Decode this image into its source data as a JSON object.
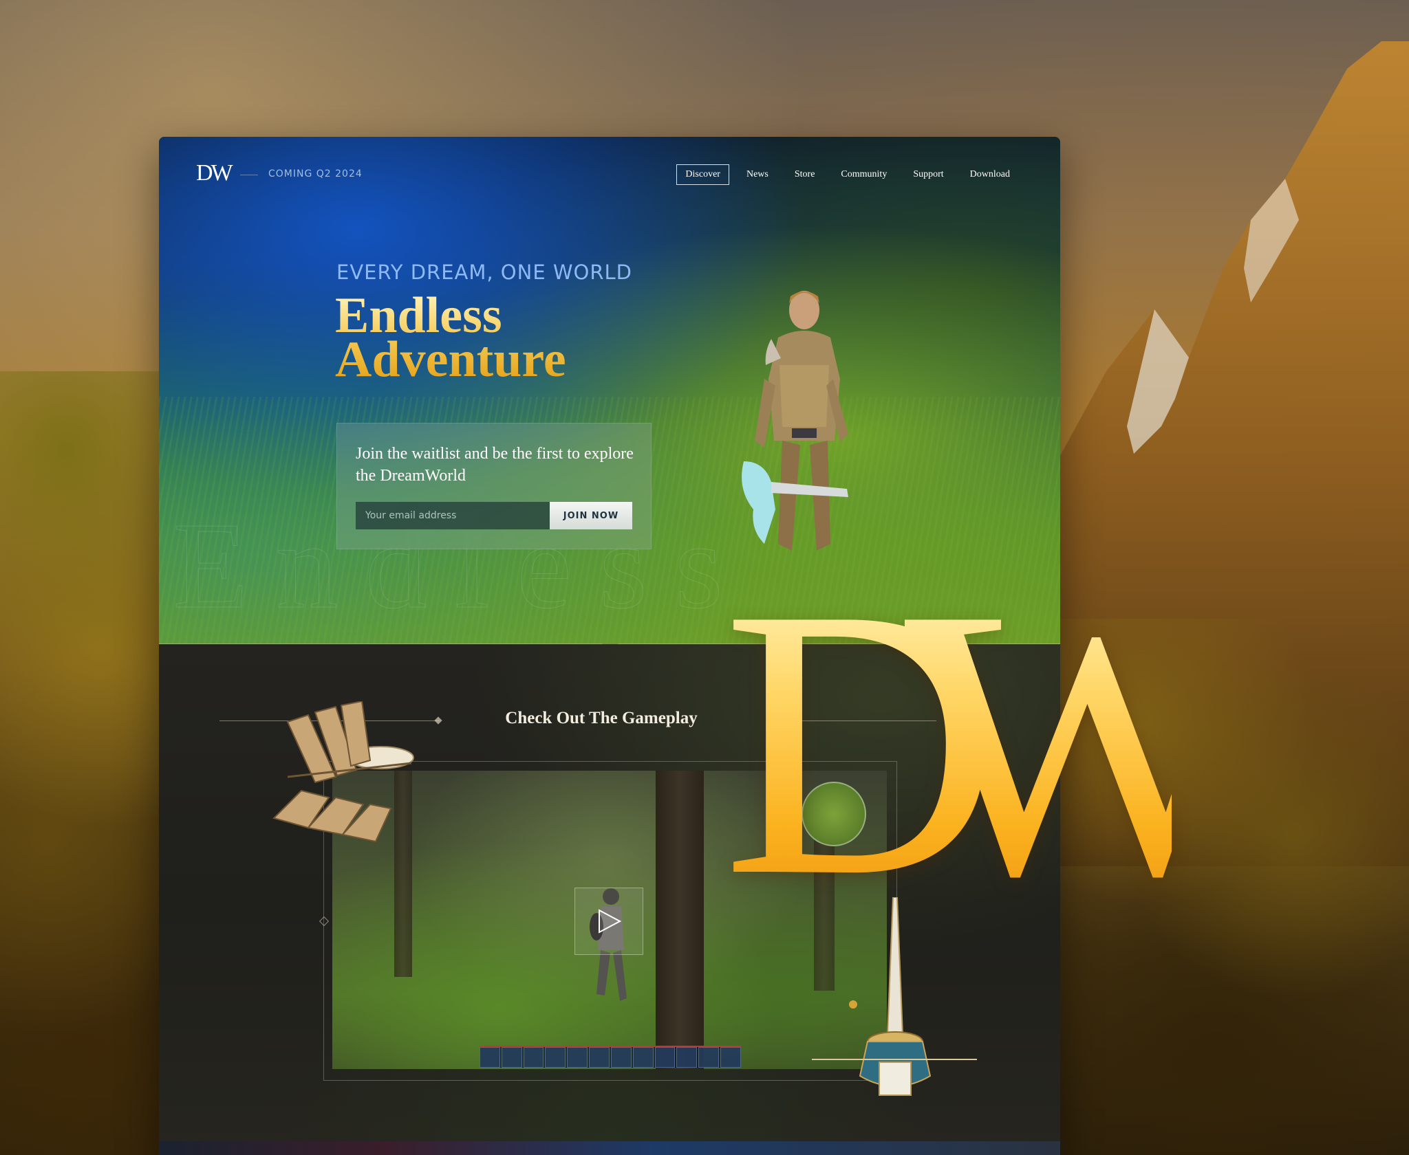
{
  "nav": {
    "logo": "DW",
    "coming_soon": "COMING Q2 2024",
    "links": [
      "Discover",
      "News",
      "Store",
      "Community",
      "Support",
      "Download"
    ],
    "active": "Discover"
  },
  "hero": {
    "tagline": "EVERY DREAM, ONE WORLD",
    "title_line1": "Endless",
    "title_line2": "Adventure",
    "waitlist_text": "Join the waitlist and be the first to explore the DreamWorld",
    "email_placeholder": "Your email address",
    "join_button": "JOIN NOW"
  },
  "gameplay": {
    "section_title": "Check Out The Gameplay"
  },
  "brand": {
    "big_logo": "DW"
  },
  "colors": {
    "gold": "#f3c64d",
    "tagline_blue": "#8fb9f5",
    "hero_blue": "#1a5ad2"
  }
}
